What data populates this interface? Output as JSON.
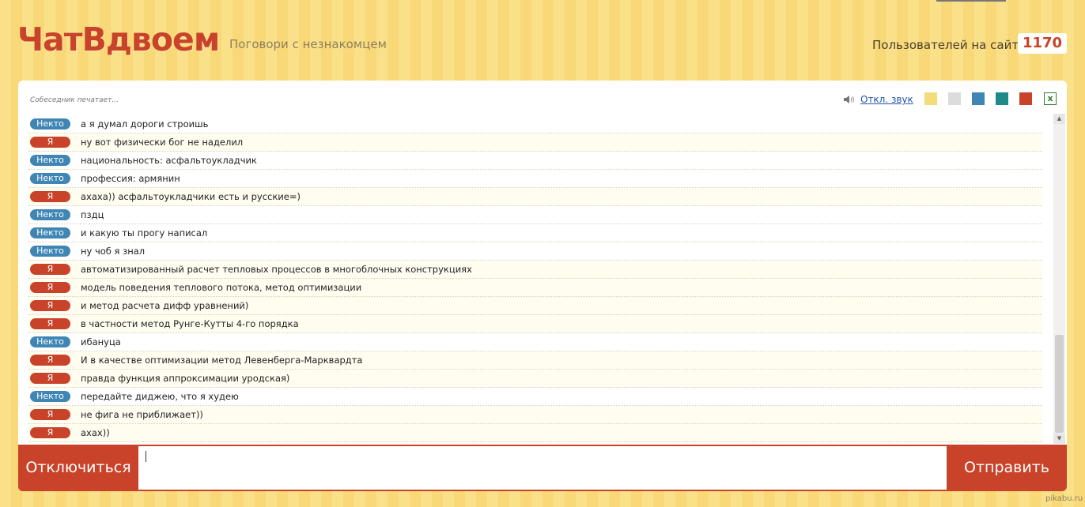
{
  "header": {
    "logo": "ЧатВдвоем",
    "tagline": "Поговори с незнакомцем",
    "users_label": "Пользователей на сайте",
    "users_count": "1170"
  },
  "toolbar": {
    "typing_status": "Собеседник печатает...",
    "sound_label": "Откл. звук",
    "swatch_colors": [
      "#f3dc7a",
      "#dcdcdc",
      "#3f86b5",
      "#1f8a8a",
      "#c8432a"
    ]
  },
  "labels": {
    "stranger": "Некто",
    "self": "Я"
  },
  "messages": [
    {
      "who": "stranger",
      "badge": "Некто",
      "text": "а я думал дороги строишь"
    },
    {
      "who": "self",
      "badge": "Я",
      "text": "ну вот физически бог не наделил"
    },
    {
      "who": "stranger",
      "badge": "Некто",
      "text": "национальность: асфальтоукладчик"
    },
    {
      "who": "stranger",
      "badge": "Некто",
      "text": "профессия: армянин"
    },
    {
      "who": "self",
      "badge": "Я",
      "text": "ахаха)) асфальтоукладчики есть и русские=)"
    },
    {
      "who": "stranger",
      "badge": "Некто",
      "text": "пздц"
    },
    {
      "who": "stranger",
      "badge": "Некто",
      "text": "и какую ты прогу написал"
    },
    {
      "who": "stranger",
      "badge": "Некто",
      "text": "ну чоб я знал"
    },
    {
      "who": "self",
      "badge": "Я",
      "text": "автоматизированный расчет тепловых процессов в многоблочных конструкциях"
    },
    {
      "who": "self",
      "badge": "Я",
      "text": "модель поведения теплового потока, метод оптимизации"
    },
    {
      "who": "self",
      "badge": "Я",
      "text": "и метод расчета дифф уравнений)"
    },
    {
      "who": "self",
      "badge": "Я",
      "text": "в частности метод Рунге-Кутты 4-го порядка"
    },
    {
      "who": "stranger",
      "badge": "Некто",
      "text": "ибануца"
    },
    {
      "who": "self",
      "badge": "Я",
      "text": "И в качестве оптимизации метод Левенберга-Марквардта"
    },
    {
      "who": "self",
      "badge": "Я",
      "text": "правда функция аппроксимации уродская)"
    },
    {
      "who": "stranger",
      "badge": "Некто",
      "text": "передайте диджею, что я худею"
    },
    {
      "who": "self",
      "badge": "Я",
      "text": "не фига не приближает))"
    },
    {
      "who": "self",
      "badge": "Я",
      "text": "ахах))"
    }
  ],
  "controls": {
    "disconnect_label": "Отключиться",
    "send_label": "Отправить",
    "input_value": ""
  },
  "watermark": "pikabu.ru"
}
